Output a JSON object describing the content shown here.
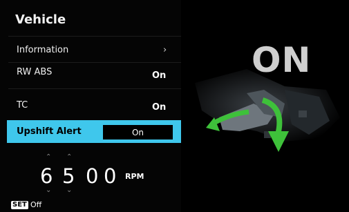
{
  "menu": {
    "title": "Vehicle",
    "items": [
      {
        "label": "Information",
        "value": "",
        "chevron": "chevron-right-icon"
      },
      {
        "label": "RW ABS",
        "value": "On"
      },
      {
        "label": "TC",
        "value": "On"
      }
    ],
    "upshift": {
      "label": "Upshift Alert",
      "value": "On"
    }
  },
  "rpm": {
    "digits": [
      "6",
      "5",
      "0",
      "0"
    ],
    "unit": "RPM"
  },
  "footer": {
    "set_icon_text": "SET",
    "set_text": "Off"
  },
  "status_big": "ON",
  "colors": {
    "highlight": "#3fc7ec",
    "arrow_green": "#3ec13a"
  }
}
